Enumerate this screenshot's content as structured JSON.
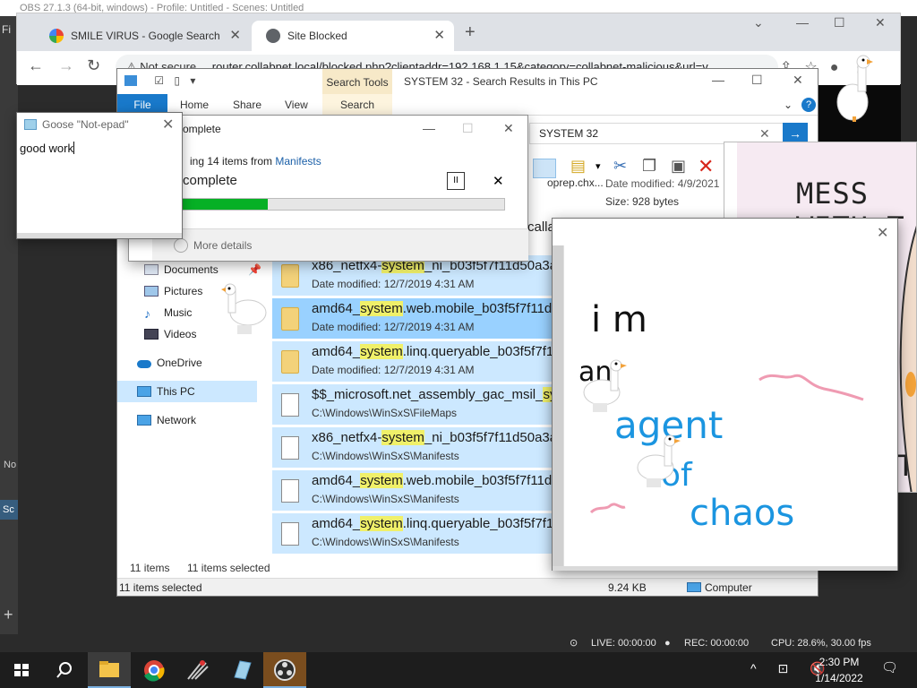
{
  "obs": {
    "title": "OBS 27.1.3 (64-bit, windows) - Profile: Untitled - Scenes: Untitled",
    "menu_first": "Fi",
    "panel_label": "No",
    "scene_label": "Sc",
    "add_symbol": "+",
    "status": {
      "live": "LIVE: 00:00:00",
      "rec": "REC: 00:00:00",
      "cpu": "CPU: 28.6%, 30.00 fps"
    }
  },
  "chrome": {
    "tabs": [
      {
        "label": "SMILE VIRUS - Google Search",
        "active": false
      },
      {
        "label": "Site Blocked",
        "active": true
      }
    ],
    "new_tab": "+",
    "address": {
      "security": "Not secure",
      "url": "router.collabnet.local/blocked.php?clientaddr=192.168.1.15&category=collabnet-malicious&url=v..."
    },
    "window_controls": {
      "min": "—",
      "max": "☐",
      "close": "✕"
    },
    "nav": {
      "back": "←",
      "forward": "→",
      "reload": "↻"
    }
  },
  "explorer": {
    "title": "SYSTEM 32 - Search Results in This PC",
    "context_tab": "Search Tools",
    "ribbon_tabs": [
      "File",
      "Home",
      "Share",
      "View",
      "Search"
    ],
    "search_box": "SYSTEM 32",
    "window_controls": {
      "min": "—",
      "max": "☐",
      "close": "✕"
    },
    "help": "?",
    "details": {
      "partial_name": "oprep.chx...",
      "date_modified": "Date modified: 4/9/2021",
      "size": "Size: 928 bytes",
      "partial_row": "calla"
    },
    "nav_items": [
      {
        "label": "Documents",
        "icon": "documents-icon"
      },
      {
        "label": "Pictures",
        "icon": "pictures-icon"
      },
      {
        "label": "Music",
        "icon": "music-icon"
      },
      {
        "label": "Videos",
        "icon": "videos-icon"
      },
      {
        "label": "OneDrive",
        "icon": "onedrive-icon"
      },
      {
        "label": "This PC",
        "icon": "this-pc-icon"
      },
      {
        "label": "Network",
        "icon": "network-icon"
      }
    ],
    "results": [
      {
        "pre": "x86_netfx4-",
        "hit": "system",
        "post": "_ni_b03f5f7f11d50a3a_",
        "meta": "Date modified: 12/7/2019 4:31 AM",
        "kind": "folder"
      },
      {
        "pre": "amd64_",
        "hit": "system",
        "post": ".web.mobile_b03f5f7f11d5",
        "meta": "Date modified: 12/7/2019 4:31 AM",
        "kind": "folder"
      },
      {
        "pre": "amd64_",
        "hit": "system",
        "post": ".linq.queryable_b03f5f7f11",
        "meta": "Date modified: 12/7/2019 4:31 AM",
        "kind": "folder"
      },
      {
        "pre": "$$_microsoft.net_assembly_gac_msil_",
        "hit": "syst",
        "post": "",
        "meta": "C:\\Windows\\WinSxS\\FileMaps",
        "kind": "file"
      },
      {
        "pre": "x86_netfx4-",
        "hit": "system",
        "post": "_ni_b03f5f7f11d50a3a_",
        "meta": "C:\\Windows\\WinSxS\\Manifests",
        "kind": "file"
      },
      {
        "pre": "amd64_",
        "hit": "system",
        "post": ".web.mobile_b03f5f7f11d5",
        "meta": "C:\\Windows\\WinSxS\\Manifests",
        "kind": "file"
      },
      {
        "pre": "amd64_",
        "hit": "system",
        "post": ".linq.queryable_b03f5f7f11",
        "meta": "C:\\Windows\\WinSxS\\Manifests",
        "kind": "file"
      }
    ],
    "status_items": "11 items",
    "status_selected": "11 items selected",
    "status_bar_selected": "11 items selected",
    "status_size": "9.24 KB",
    "status_location": "Computer"
  },
  "copy_dialog": {
    "title": "omplete",
    "items_prefix": "ing 14 items from ",
    "items_link": "Manifests",
    "percent": "complete",
    "progress": 0.27,
    "pause": "II",
    "cancel": "✕",
    "more_details": "More details",
    "window_controls": {
      "min": "—",
      "max": "☐",
      "close": "✕"
    }
  },
  "goose_notepad": {
    "title": "Goose \"Not-epad\"",
    "close": "✕",
    "text": "good work"
  },
  "meme": {
    "text": "MESS WITH T",
    "text2": "TH"
  },
  "chaos_window": {
    "close": "✕",
    "words": [
      "i m",
      "an",
      "agent",
      "of",
      "chaos"
    ]
  },
  "taskbar": {
    "time": "2:30 PM",
    "date": "1/14/2022",
    "tray": "^ ⊡ 🔇"
  },
  "colors": {
    "explorer_selection": "#cce8ff",
    "explorer_hover": "#99d1ff",
    "search_highlight": "#f0f069",
    "file_tab": "#1979ca",
    "progress_green": "#06b025"
  }
}
